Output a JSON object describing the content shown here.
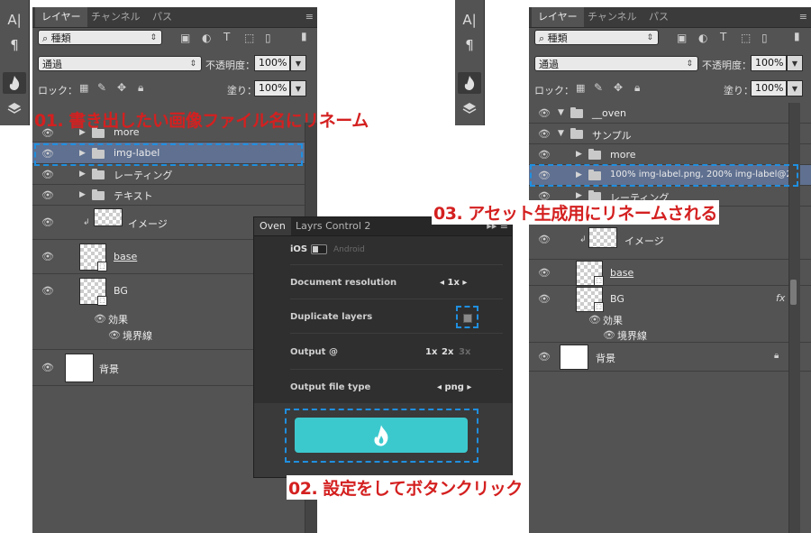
{
  "layers_panel": {
    "tabs": [
      "レイヤー",
      "チャンネル",
      "パス"
    ],
    "filter_label": "種類",
    "blend_mode": "通過",
    "opacity_label": "不透明度：",
    "opacity_value": "100%",
    "lock_label": "ロック：",
    "fill_label": "塗り：",
    "fill_value": "100%",
    "effects_label": "効果",
    "stroke_label": "境界線",
    "fx": "fx"
  },
  "left_layers": [
    "more",
    "img-label",
    "レーティング",
    "テキスト",
    "イメージ",
    "base",
    "BG",
    "背景"
  ],
  "right_layers": [
    "__oven",
    "サンプル",
    "more",
    "100% img-label.png, 200% img-label@2...",
    "レーティング",
    "イメージ",
    "base",
    "BG",
    "背景"
  ],
  "oven": {
    "tabs": [
      "Oven",
      "Layrs Control 2"
    ],
    "ios": "iOS",
    "android": "Android",
    "doc_res_label": "Document resolution",
    "doc_res_value": "1x",
    "dup_label": "Duplicate layers",
    "output_label": "Output @",
    "output_1x": "1x",
    "output_2x": "2x",
    "output_3x": "3x",
    "file_type_label": "Output file type",
    "file_type_value": "png"
  },
  "annotations": {
    "step1": "01. 書き出したい画像ファイル名にリネーム",
    "step2": "02. 設定をしてボタンクリック",
    "step3": "03. アセット生成用にリネームされる"
  },
  "colors": {
    "panel_bg": "#535353",
    "selected_row": "#5f7090",
    "bake_button": "#3cc9ce",
    "annotation_red": "#d42020",
    "annotation_blue": "#1f8fe0"
  }
}
